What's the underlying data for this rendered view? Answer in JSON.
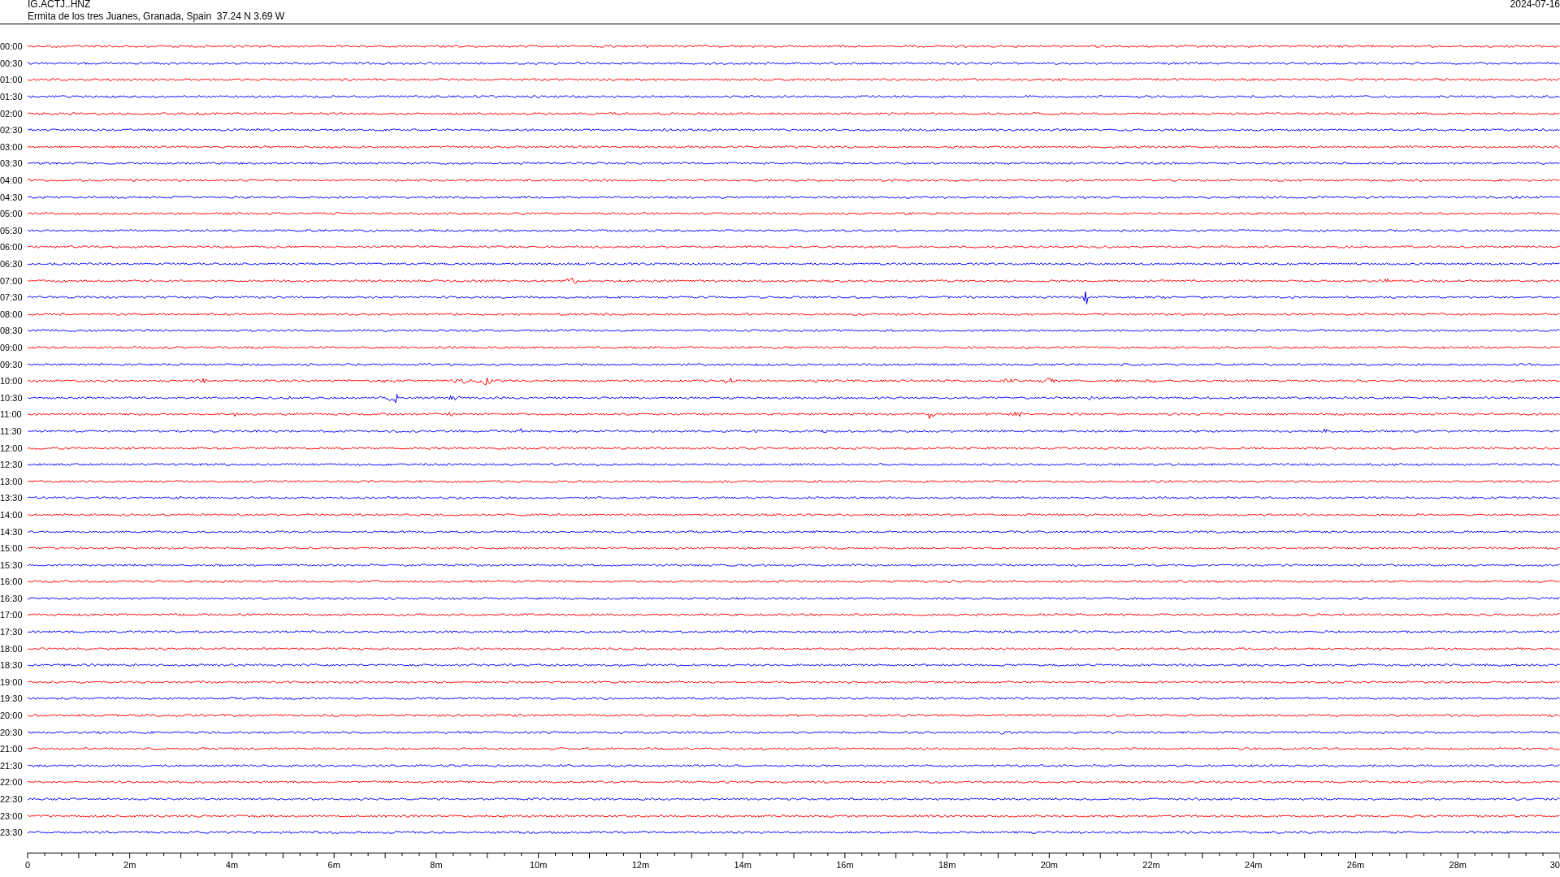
{
  "header": {
    "station": "IG.ACTJ..HNZ",
    "location": "Ermita de los tres Juanes, Granada, Spain  37.24 N 3.69 W",
    "date": "2024-07-16"
  },
  "traces": [
    {
      "label": "00:00",
      "color": "#ff0000"
    },
    {
      "label": "00:30",
      "color": "#0000ff"
    },
    {
      "label": "01:00",
      "color": "#ff0000"
    },
    {
      "label": "01:30",
      "color": "#0000ff"
    },
    {
      "label": "02:00",
      "color": "#ff0000"
    },
    {
      "label": "02:30",
      "color": "#0000ff"
    },
    {
      "label": "03:00",
      "color": "#ff0000"
    },
    {
      "label": "03:30",
      "color": "#0000ff"
    },
    {
      "label": "04:00",
      "color": "#ff0000"
    },
    {
      "label": "04:30",
      "color": "#0000ff"
    },
    {
      "label": "05:00",
      "color": "#ff0000"
    },
    {
      "label": "05:30",
      "color": "#0000ff"
    },
    {
      "label": "06:00",
      "color": "#ff0000"
    },
    {
      "label": "06:30",
      "color": "#0000ff"
    },
    {
      "label": "07:00",
      "color": "#ff0000"
    },
    {
      "label": "07:30",
      "color": "#0000ff"
    },
    {
      "label": "08:00",
      "color": "#ff0000"
    },
    {
      "label": "08:30",
      "color": "#0000ff"
    },
    {
      "label": "09:00",
      "color": "#ff0000"
    },
    {
      "label": "09:30",
      "color": "#0000ff"
    },
    {
      "label": "10:00",
      "color": "#ff0000"
    },
    {
      "label": "10:30",
      "color": "#0000ff"
    },
    {
      "label": "11:00",
      "color": "#ff0000"
    },
    {
      "label": "11:30",
      "color": "#0000ff"
    },
    {
      "label": "12:00",
      "color": "#ff0000"
    },
    {
      "label": "12:30",
      "color": "#0000ff"
    },
    {
      "label": "13:00",
      "color": "#ff0000"
    },
    {
      "label": "13:30",
      "color": "#0000ff"
    },
    {
      "label": "14:00",
      "color": "#ff0000"
    },
    {
      "label": "14:30",
      "color": "#0000ff"
    },
    {
      "label": "15:00",
      "color": "#ff0000"
    },
    {
      "label": "15:30",
      "color": "#0000ff"
    },
    {
      "label": "16:00",
      "color": "#ff0000"
    },
    {
      "label": "16:30",
      "color": "#0000ff"
    },
    {
      "label": "17:00",
      "color": "#ff0000"
    },
    {
      "label": "17:30",
      "color": "#0000ff"
    },
    {
      "label": "18:00",
      "color": "#ff0000"
    },
    {
      "label": "18:30",
      "color": "#0000ff"
    },
    {
      "label": "19:00",
      "color": "#ff0000"
    },
    {
      "label": "19:30",
      "color": "#0000ff"
    },
    {
      "label": "20:00",
      "color": "#ff0000"
    },
    {
      "label": "20:30",
      "color": "#0000ff"
    },
    {
      "label": "21:00",
      "color": "#ff0000"
    },
    {
      "label": "21:30",
      "color": "#0000ff"
    },
    {
      "label": "22:00",
      "color": "#ff0000"
    },
    {
      "label": "22:30",
      "color": "#0000ff"
    },
    {
      "label": "23:00",
      "color": "#ff0000"
    },
    {
      "label": "23:30",
      "color": "#0000ff"
    }
  ],
  "x_axis": {
    "ticks": [
      "0",
      "2m",
      "4m",
      "6m",
      "8m",
      "10m",
      "12m",
      "14m",
      "16m",
      "18m",
      "20m",
      "22m",
      "24m",
      "26m",
      "28m",
      "30"
    ]
  }
}
